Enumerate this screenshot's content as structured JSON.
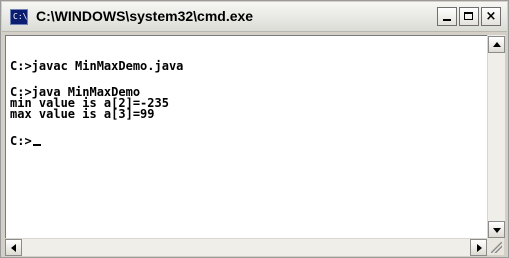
{
  "window": {
    "title": "C:\\WINDOWS\\system32\\cmd.exe",
    "icon_text": "C:\\",
    "close_glyph": "×"
  },
  "console": {
    "lines": [
      "C:>javac MinMaxDemo.java",
      "C:>java MinMaxDemo",
      "min value is a[2]=-235",
      "max value is a[3]=99",
      "C:>"
    ]
  },
  "icons": {
    "system": "cmd-icon",
    "minimize": "minimize-icon",
    "maximize": "maximize-icon",
    "close": "close-icon"
  }
}
